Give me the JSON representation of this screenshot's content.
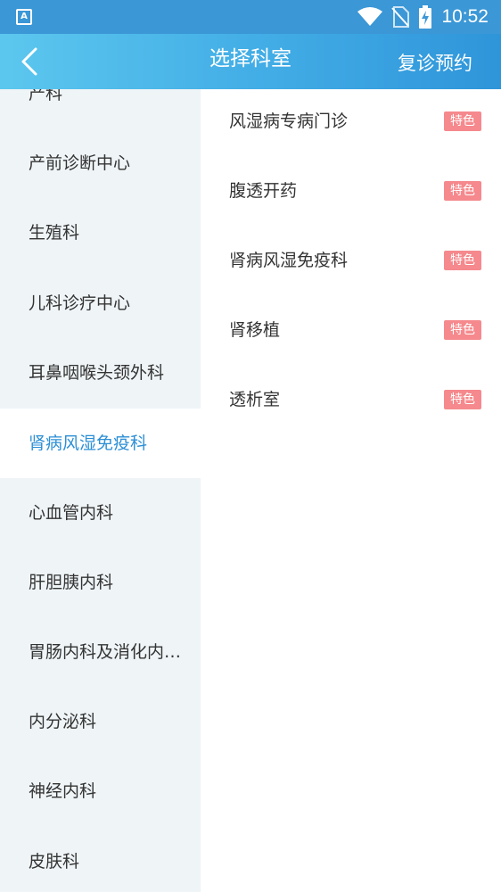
{
  "status_bar": {
    "time": "10:52",
    "app_icon_letter": "A",
    "icons": [
      "wifi-icon",
      "no-sim-icon",
      "battery-charging-icon"
    ]
  },
  "header": {
    "title": "选择科室",
    "right_action": "复诊预约",
    "back_icon": "chevron-left-icon"
  },
  "departments": {
    "items": [
      {
        "label": "产科",
        "selected": false
      },
      {
        "label": "产前诊断中心",
        "selected": false
      },
      {
        "label": "生殖科",
        "selected": false
      },
      {
        "label": "儿科诊疗中心",
        "selected": false
      },
      {
        "label": "耳鼻咽喉头颈外科",
        "selected": false
      },
      {
        "label": "肾病风湿免疫科",
        "selected": true
      },
      {
        "label": "心血管内科",
        "selected": false
      },
      {
        "label": "肝胆胰内科",
        "selected": false
      },
      {
        "label": "胃肠内科及消化内…",
        "selected": false
      },
      {
        "label": "内分泌科",
        "selected": false
      },
      {
        "label": "神经内科",
        "selected": false
      },
      {
        "label": "皮肤科",
        "selected": false
      }
    ]
  },
  "clinics": {
    "items": [
      {
        "name": "风湿病专病门诊",
        "badge": "特色"
      },
      {
        "name": "腹透开药",
        "badge": "特色"
      },
      {
        "name": "肾病风湿免疫科",
        "badge": "特色"
      },
      {
        "name": "肾移植",
        "badge": "特色"
      },
      {
        "name": "透析室",
        "badge": "特色"
      }
    ]
  },
  "colors": {
    "status_bar": "#3b97d6",
    "header_gradient_start": "#5cc7ee",
    "header_gradient_end": "#2f95da",
    "selected_text": "#2d8fd6",
    "left_panel_bg": "#eff4f7",
    "badge_bg": "#f5898d"
  }
}
